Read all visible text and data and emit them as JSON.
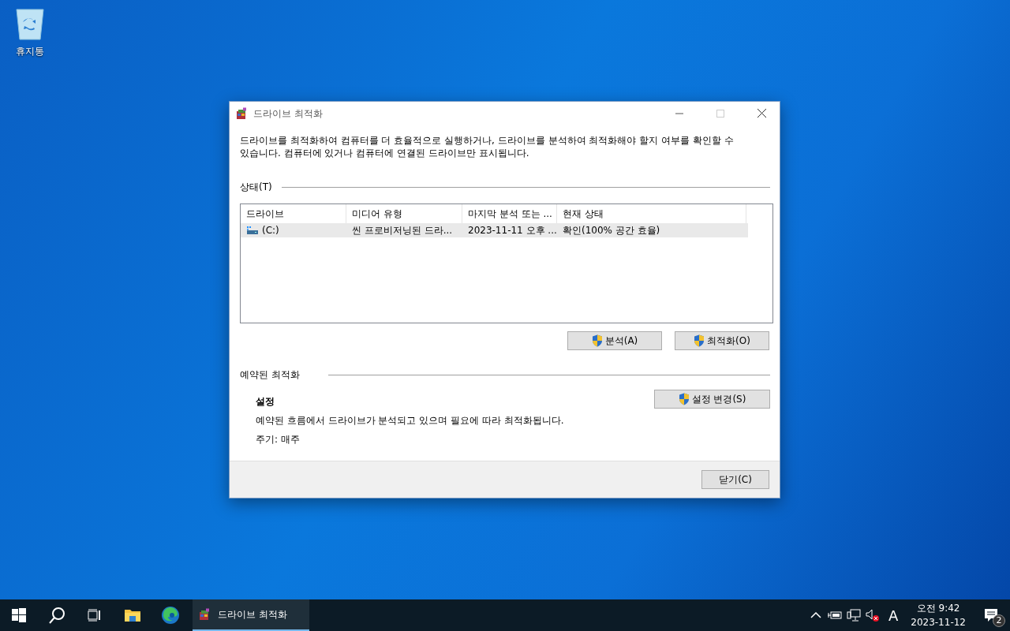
{
  "desktop": {
    "icons": [
      {
        "label": "휴지통"
      }
    ]
  },
  "window": {
    "title": "드라이브 최적화",
    "description": "드라이브를 최적화하여 컴퓨터를 더 효율적으로 실행하거나, 드라이브를 분석하여 최적화해야 할지 여부를 확인할 수 있습니다. 컴퓨터에 있거나 컴퓨터에 연결된 드라이브만 표시됩니다.",
    "status_section": {
      "heading": "상태(T)",
      "table": {
        "columns": [
          "드라이브",
          "미디어 유형",
          "마지막 분석 또는 ...",
          "현재 상태"
        ],
        "rows": [
          {
            "cells": [
              "(C:)",
              "씬 프로비저닝된 드라...",
              "2023-11-11 오후 ...",
              "확인(100% 공간 효율)"
            ],
            "selected": true
          }
        ]
      },
      "buttons": [
        "분석(A)",
        "최적화(O)"
      ]
    },
    "scheduled_section": {
      "heading": "예약된 최적화",
      "settings_title": "설정",
      "description": "예약된 흐름에서 드라이브가 분석되고 있으며 필요에 따라 최적화됩니다.",
      "frequency": "주기: 매주",
      "button": "설정 변경(S)"
    },
    "close_button": "닫기(C)"
  },
  "taskbar": {
    "apps": [
      {
        "label": "드라이브 최적화",
        "active": true
      }
    ],
    "tray": {
      "input_indicator": "A",
      "time": "오전 9:42",
      "date": "2023-11-12",
      "notification_count": "2"
    }
  }
}
